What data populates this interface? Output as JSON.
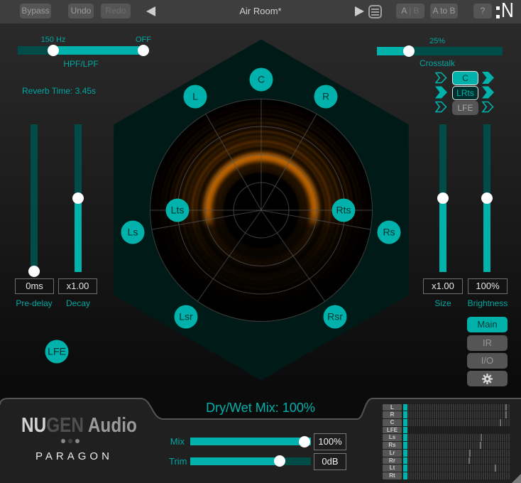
{
  "titlebar": {
    "bypass": "Bypass",
    "undo": "Undo",
    "redo": "Redo",
    "preset": "Air Room*",
    "ab_a": "A",
    "ab_b": "| B",
    "a_to_b": "A to B",
    "help": "?",
    "brand_letter": "N"
  },
  "filters": {
    "hpf_value": "150 Hz",
    "lpf_value": "OFF",
    "label": "HPF/LPF"
  },
  "reverb_time": "Reverb Time: 3.45s",
  "crosstalk": {
    "value": "25%",
    "label": "Crosstalk"
  },
  "routing": {
    "rows": [
      {
        "label": "C",
        "in_filled": false,
        "out_filled": true
      },
      {
        "label": "LRts",
        "in_filled": true,
        "out_filled": true
      },
      {
        "label": "LFE",
        "in_filled": false,
        "out_filled": false
      }
    ]
  },
  "left_sliders": {
    "pre_delay": {
      "value": "0ms",
      "label": "Pre-delay"
    },
    "decay": {
      "value": "x1.00",
      "label": "Decay"
    }
  },
  "right_sliders": {
    "size": {
      "value": "x1.00",
      "label": "Size"
    },
    "brightness": {
      "value": "100%",
      "label": "Brightness"
    }
  },
  "speaker_nodes": [
    "C",
    "L",
    "R",
    "Lts",
    "Rts",
    "Ls",
    "Rs",
    "Lsr",
    "Rsr",
    "LFE"
  ],
  "view_buttons": {
    "main": "Main",
    "ir": "IR",
    "io": "I/O"
  },
  "footer": {
    "brand_nu": "NU",
    "brand_gen": "GEN",
    "brand_audio": " Audio",
    "product": "PARAGON",
    "dry_wet": "Dry/Wet Mix: 100%",
    "mix_label": "Mix",
    "mix_value": "100%",
    "trim_label": "Trim",
    "trim_value": "0dB"
  },
  "meters": {
    "channels": [
      "L",
      "R",
      "C",
      "LFE",
      "Ls",
      "Rs",
      "Lr",
      "Rr",
      "Lt",
      "Rt"
    ],
    "peaks_pct": [
      95.8,
      95.8,
      90.2,
      null,
      71.3,
      70.6,
      60.1,
      59.4,
      85.3,
      null
    ],
    "signal_dim": [
      false,
      false,
      false,
      true,
      false,
      false,
      false,
      false,
      false,
      false
    ]
  },
  "colors": {
    "accent": "#00b2ab",
    "accent_dark": "#004c49",
    "hexagon": "#001a18",
    "radar_orange": "#c06000"
  }
}
